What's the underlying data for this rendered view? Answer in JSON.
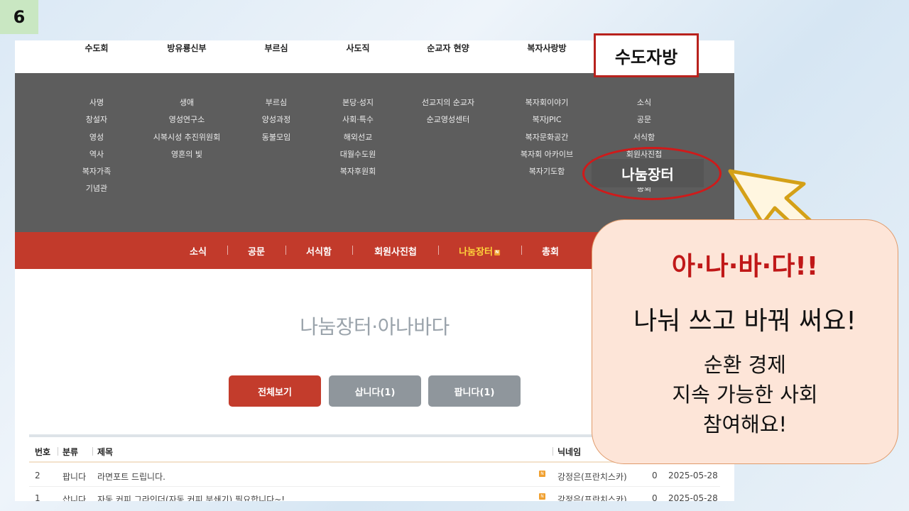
{
  "slide_number": "6",
  "top_nav": [
    "수도회",
    "방유룡신부",
    "부르심",
    "사도직",
    "순교자 현양",
    "복자사랑방"
  ],
  "mega_menu": [
    [
      "사명",
      "창설자",
      "영성",
      "역사",
      "복자가족",
      "기념관"
    ],
    [
      "생애",
      "영성연구소",
      "시복시성 추진위원회",
      "영혼의 빛"
    ],
    [
      "부르심",
      "양성과정",
      "동불모임"
    ],
    [
      "본당·성지",
      "사회·특수",
      "해외선교",
      "대월수도원",
      "복자후원회"
    ],
    [
      "선교지의 순교자",
      "순교영성센터"
    ],
    [
      "복자회이야기",
      "복자JPIC",
      "복자문화공간",
      "복자회 아카이브",
      "복자기도함"
    ],
    [
      "소식",
      "공문",
      "서식함",
      "회원사진첩",
      "",
      "총회"
    ]
  ],
  "sub_nav": [
    "소식",
    "공문",
    "서식함",
    "회원사진첩",
    "나눔장터",
    "총회"
  ],
  "new_badge": "N",
  "page_title": "나눔장터·아나바다",
  "filter_buttons": {
    "all": "전체보기",
    "buy": "삽니다(1)",
    "sell": "팝니다(1)"
  },
  "table": {
    "headers": {
      "no": "번호",
      "category": "분류",
      "title": "제목",
      "nickname": "닉네임"
    },
    "rows": [
      {
        "no": "2",
        "category": "팝니다",
        "title": "라면포트 드립니다.",
        "nickname": "강정은(프란치스카)",
        "views": "0",
        "date": "2025-05-28"
      },
      {
        "no": "1",
        "category": "삽니다",
        "title": "자동 커피 그라인더(자동 커피 분쇄기) 필요합니다~!",
        "nickname": "강정은(프란치스카)",
        "views": "0",
        "date": "2025-05-28"
      }
    ]
  },
  "annotations": {
    "callout_title": "수도자방",
    "highlight_label": "나눔장터",
    "speech_line1": "아·나·바·다!!",
    "speech_line2": "나눠 쓰고 바꿔 써요!",
    "speech_line3": "순환 경제",
    "speech_line4": "지속 가능한 사회",
    "speech_line5": "참여해요!"
  },
  "colors": {
    "accent_red": "#c23a2b",
    "menu_gray": "#5d5d5d",
    "active_yellow": "#ffd43b",
    "arrow_gold": "#d4a017"
  }
}
